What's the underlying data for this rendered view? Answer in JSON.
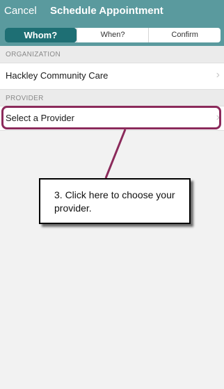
{
  "header": {
    "cancel_label": "Cancel",
    "title": "Schedule Appointment",
    "tabs": [
      {
        "label": "Whom?",
        "active": true
      },
      {
        "label": "When?",
        "active": false
      },
      {
        "label": "Confirm",
        "active": false
      }
    ]
  },
  "organization": {
    "section_label": "ORGANIZATION",
    "value": "Hackley Community Care"
  },
  "provider": {
    "section_label": "PROVIDER",
    "value": "Select a Provider"
  },
  "callout": {
    "text": "3. Click here to choose your provider."
  },
  "colors": {
    "header_bg": "#5a9a9e",
    "active_tab": "#1e6f74",
    "highlight": "#8b2a5b"
  },
  "icons": {
    "row_chevron": "chevron-right-icon"
  }
}
